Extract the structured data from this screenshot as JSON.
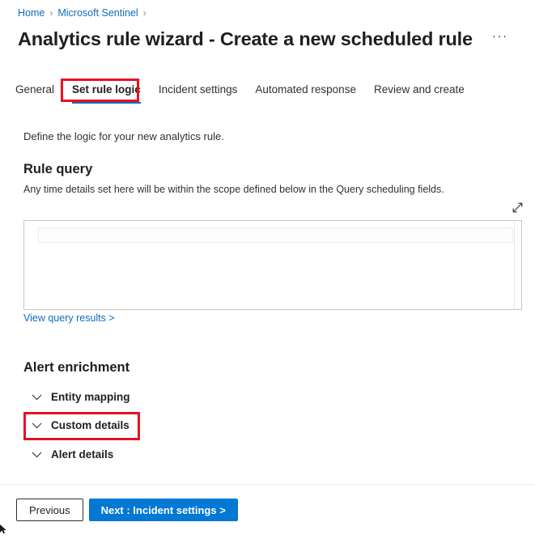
{
  "breadcrumb": {
    "items": [
      {
        "label": "Home"
      },
      {
        "label": "Microsoft Sentinel"
      }
    ],
    "separator": "›"
  },
  "header": {
    "title": "Analytics rule wizard - Create a new scheduled rule",
    "more_options_label": "···",
    "more_options_name": "more-options-icon"
  },
  "tabs": [
    {
      "label": "General",
      "active": false
    },
    {
      "label": "Set rule logic",
      "active": true
    },
    {
      "label": "Incident settings",
      "active": false
    },
    {
      "label": "Automated response",
      "active": false
    },
    {
      "label": "Review and create",
      "active": false
    }
  ],
  "main": {
    "intro": "Define the logic for your new analytics rule.",
    "rule_query": {
      "heading": "Rule query",
      "note": "Any time details set here will be within the scope defined below in the Query scheduling fields.",
      "editor_value": "",
      "editor_placeholder": "",
      "expand_icon": "expand-diagonal-icon",
      "results_link": "View query results >"
    },
    "alert_enrichment": {
      "heading": "Alert enrichment",
      "sections": [
        {
          "label": "Entity mapping",
          "expanded": false,
          "icon": "chevron-down-icon"
        },
        {
          "label": "Custom details",
          "expanded": false,
          "icon": "chevron-down-icon"
        },
        {
          "label": "Alert details",
          "expanded": false,
          "icon": "chevron-down-icon"
        }
      ]
    }
  },
  "footer": {
    "previous_label": "Previous",
    "next_label": "Next : Incident settings >"
  },
  "annotations": [
    {
      "target": "Set rule logic",
      "color": "#e81123"
    },
    {
      "target": "Custom details",
      "color": "#e81123"
    }
  ],
  "colors": {
    "link": "#0f6cbd",
    "primary_button": "#0078d4",
    "annotation": "#e81123",
    "tab_underline": "#0f6cbd",
    "text": "#323130",
    "border": "#c8c6c4"
  }
}
